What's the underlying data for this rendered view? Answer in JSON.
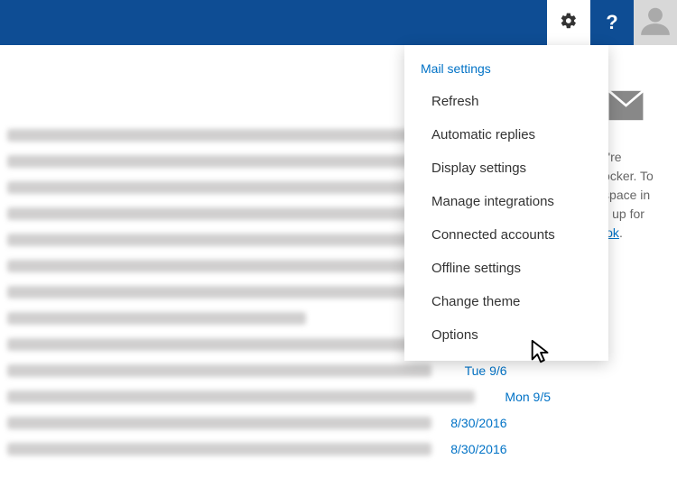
{
  "topbar": {
    "gear_name": "gear-icon",
    "help_name": "help-icon",
    "avatar_name": "avatar"
  },
  "settings_menu": {
    "header": "Mail settings",
    "items": [
      "Refresh",
      "Automatic replies",
      "Display settings",
      "Manage integrations",
      "Connected accounts",
      "Offline settings",
      "Change theme",
      "Options"
    ]
  },
  "mail_dates": [
    "Tue 9/6",
    "Mon 9/5",
    "8/30/2016",
    "8/30/2016"
  ],
  "ad_text_fragments": {
    "line1": "like you're",
    "line2": "n ad blocker. To",
    "line3": "ze the space in",
    "line4": "ox, sign up for",
    "link": "e Outlook",
    "period": "."
  }
}
